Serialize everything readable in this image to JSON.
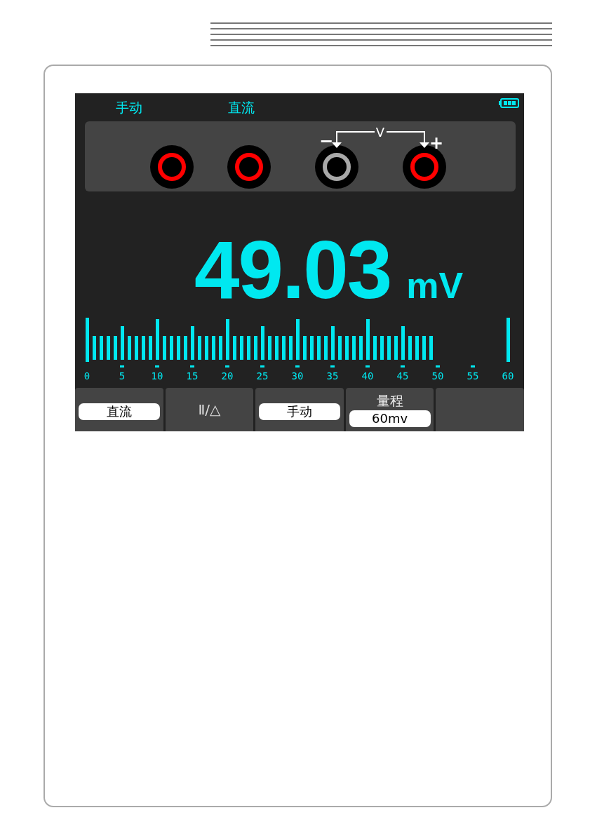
{
  "status": {
    "mode": "手动",
    "coupling": "直流"
  },
  "terminals": [
    {
      "color": "#ff0000"
    },
    {
      "color": "#ff0000"
    },
    {
      "color": "#a8a8a8"
    },
    {
      "color": "#ff0000"
    }
  ],
  "probe": {
    "label": "V",
    "negative": "−",
    "positive": "+"
  },
  "reading": {
    "value": "49.03",
    "unit": "mV"
  },
  "bargraph": {
    "level": 0.817,
    "scale": [
      "0",
      "5",
      "10",
      "15",
      "20",
      "25",
      "30",
      "35",
      "40",
      "45",
      "50",
      "55",
      "60"
    ]
  },
  "softkeys": [
    {
      "kind": "pill",
      "label": "直流"
    },
    {
      "kind": "plain",
      "label": "Ⅱ/△"
    },
    {
      "kind": "pill",
      "label": "手动"
    },
    {
      "kind": "titled",
      "title": "量程",
      "label": "60mv"
    },
    {
      "kind": "empty"
    }
  ]
}
